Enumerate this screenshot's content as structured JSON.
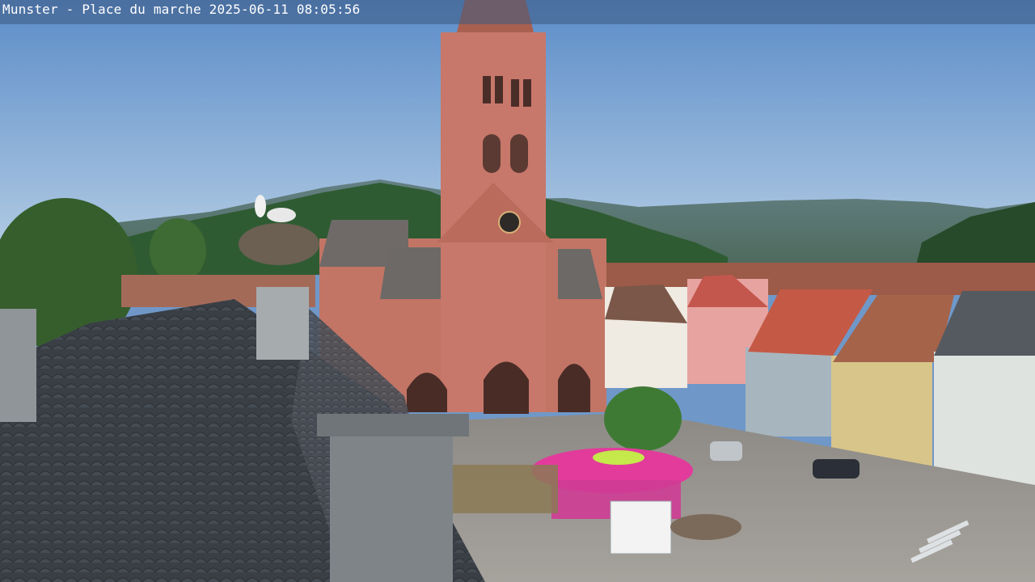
{
  "overlay": {
    "caption": "Munster - Place du marche 2025-06-11 08:05:56"
  },
  "colors": {
    "sky_top": "#5b8cc8",
    "sky_bottom": "#b7cfe5",
    "church": "#c67a6a",
    "roof": "#3c4148",
    "kiosk": "#e23b9c"
  }
}
